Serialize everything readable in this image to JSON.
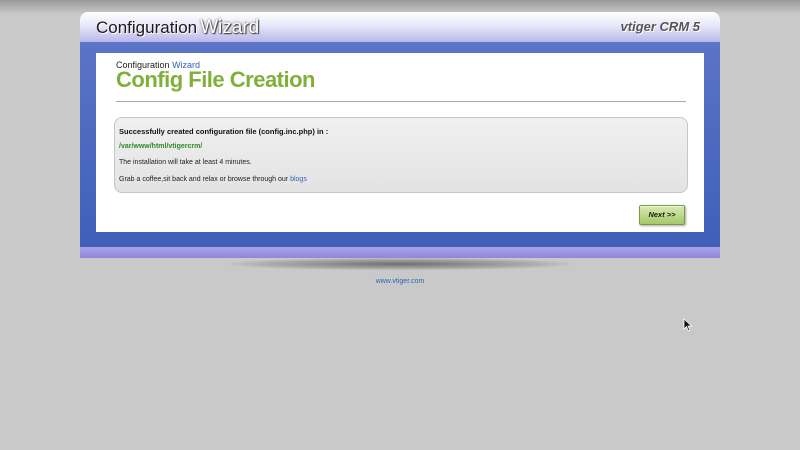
{
  "header": {
    "brand_prefix": "Configuration",
    "brand_highlight": "Wizard",
    "product": "vtiger CRM 5"
  },
  "page": {
    "breadcrumb_prefix": "Configuration",
    "breadcrumb_accent": "Wizard",
    "title": "Config File Creation"
  },
  "message": {
    "title": "Successfully created configuration file (config.inc.php) in :",
    "path": "/var/www/html/vtigercrm/",
    "time_note": "The installation will take at least 4 minutes.",
    "blog_text": "Grab a coffee,sit back and relax or browse through our",
    "blog_link": "blogs"
  },
  "buttons": {
    "next_label": "Next >>"
  },
  "footer": {
    "link": "www.vtiger.com"
  },
  "colors": {
    "title_green": "#7fb13a",
    "frame_blue": "#4a68bf",
    "link_blue": "#2f64b8",
    "path_green": "#2d8a27"
  }
}
